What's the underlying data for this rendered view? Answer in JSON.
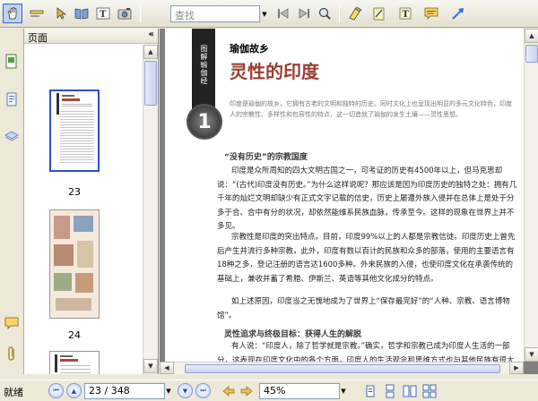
{
  "toolbar": {
    "search_placeholder": "查找",
    "icons": [
      "hand-icon",
      "select-text-icon",
      "pointer-icon",
      "book-icon",
      "text-icon",
      "camera-icon",
      "prev-icon",
      "next-icon",
      "search-icon",
      "highlight-icon",
      "note-icon",
      "text-note-icon",
      "comment-icon",
      "arrow-icon"
    ]
  },
  "sidebar": {
    "title": "页面",
    "collapse_glyph": "«",
    "thumbnails": [
      {
        "label": "23"
      },
      {
        "label": "24"
      }
    ]
  },
  "page": {
    "kicker": "瑜伽故乡",
    "headline": "灵性的印度",
    "strip_text": "图解瑜伽经",
    "chapter_number": "1",
    "lede": "印度是瑜伽的故乡，它拥有古老的文明和独特的历史。同时文化上也呈现出明显的多元文化特色，印度人的宗教性、多样性和包容性的特点，这一切造就了瑜伽的发生土壤——灵性思想。",
    "sections": [
      {
        "title": "“没有历史”的宗教国度",
        "paragraphs": [
          "印度是众所周知的四大文明古国之一，可考证的历史有4500年以上，但马克思却说：“(古代)印度没有历史。”为什么这样说呢？那应该是因为印度历史的独特之处：拥有几千年的灿烂文明却缺少有正式文字记载的信史，历史上屡遭外族入侵并在总体上是处于分多于合、合中有分的状况，却依然能维系民族血脉，传承至今。这样的现象在世界上并不多见。",
          "宗教性是印度的突出特点。目前，印度99%以上的人都是宗教信徒。印度历史上曾先后产生并流行多种宗教，此外，印度有数以百计的民族和众多的部落，使用的主要语言有18种之多，登记注册的语言达1600多种。外来民族的入侵，也使印度文化在承袭传统的基础上，兼收并蓄了希腊、伊斯兰、英语等其他文化成分的特点。",
          "如上述原因，印度当之无愧地成为了世界上“保存最完好”的“人种、宗教、语言博物馆”。"
        ]
      },
      {
        "title": "灵性追求与终极目标：获得人生的解脱",
        "paragraphs": [
          "有人说：“印度人，除了哲学就是宗教。”确实，哲学和宗教已成为印度人生活的一部分，这表现在印度文化中的各个方面，印度人的生活观念和思维方式也与其他民族有很大差别。"
        ]
      }
    ]
  },
  "statusbar": {
    "status": "就绪",
    "page_indicator": "23 / 348",
    "zoom": "45%"
  },
  "colors": {
    "headline": "#9a3e33",
    "selection": "#2b4fd1"
  }
}
